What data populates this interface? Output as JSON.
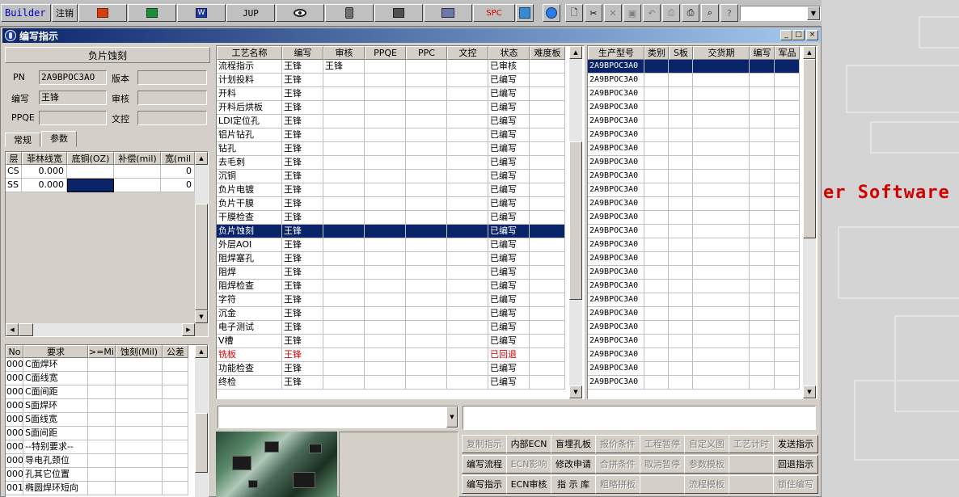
{
  "toolbar": {
    "builder_label": "Builder",
    "logout_label": "注销",
    "jup_label": "JUP",
    "spc_label": "SPC",
    "dropdown_value": ""
  },
  "background": {
    "text": "er Software"
  },
  "window": {
    "title": "编写指示",
    "min": "_",
    "max": "□",
    "close": "×"
  },
  "left": {
    "process_title": "负片蚀刻",
    "pn_label": "PN",
    "pn_value": "2A9BPOC3AO",
    "version_label": "版本",
    "version_value": "",
    "writer_label": "编写",
    "writer_value": "王锋",
    "review_label": "审核",
    "review_value": "",
    "ppqe_label": "PPQE",
    "ppqe_value": "",
    "doc_label": "文控",
    "doc_value": "",
    "tabs": [
      "常规",
      "参数"
    ],
    "layer_grid": {
      "headers": [
        "层",
        "菲林线宽",
        "底铜(OZ)",
        "补偿(mil)",
        "宽(mil"
      ],
      "rows": [
        {
          "layer": "CS",
          "film": "0.000",
          "copper": "",
          "comp": "",
          "width": "0"
        },
        {
          "layer": "SS",
          "film": "0.000",
          "copper": "",
          "comp": "",
          "width": "0"
        }
      ]
    },
    "req_grid": {
      "headers": [
        "No",
        "要求",
        ">=Mil",
        "蚀刻(Mil)",
        "公差"
      ],
      "rows": [
        {
          "no": "000",
          "req": "C面焊环"
        },
        {
          "no": "000",
          "req": "C面线宽"
        },
        {
          "no": "000",
          "req": "C面间距"
        },
        {
          "no": "000",
          "req": "S面焊环"
        },
        {
          "no": "000",
          "req": "S面线宽"
        },
        {
          "no": "000",
          "req": "S面间距"
        },
        {
          "no": "000",
          "req": "--特别要求--"
        },
        {
          "no": "000",
          "req": "导电孔颈位"
        },
        {
          "no": "000",
          "req": "孔其它位置"
        },
        {
          "no": "001",
          "req": "椭圆焊环短向"
        }
      ]
    }
  },
  "process_grid": {
    "headers": [
      "工艺名称",
      "编写",
      "审核",
      "PPQE",
      "PPC",
      "文控",
      "状态",
      "难度板"
    ],
    "rows": [
      {
        "name": "流程指示",
        "writer": "王锋",
        "review": "王锋",
        "status": "已审核"
      },
      {
        "name": "计划投料",
        "writer": "王锋",
        "review": "",
        "status": "已编写"
      },
      {
        "name": "开料",
        "writer": "王锋",
        "review": "",
        "status": "已编写"
      },
      {
        "name": "开料后烘板",
        "writer": "王锋",
        "review": "",
        "status": "已编写"
      },
      {
        "name": "LDI定位孔",
        "writer": "王锋",
        "review": "",
        "status": "已编写"
      },
      {
        "name": "铝片钻孔",
        "writer": "王锋",
        "review": "",
        "status": "已编写"
      },
      {
        "name": "钻孔",
        "writer": "王锋",
        "review": "",
        "status": "已编写"
      },
      {
        "name": "去毛刺",
        "writer": "王锋",
        "review": "",
        "status": "已编写"
      },
      {
        "name": "沉铜",
        "writer": "王锋",
        "review": "",
        "status": "已编写"
      },
      {
        "name": "负片电镀",
        "writer": "王锋",
        "review": "",
        "status": "已编写"
      },
      {
        "name": "负片干膜",
        "writer": "王锋",
        "review": "",
        "status": "已编写"
      },
      {
        "name": "干膜检查",
        "writer": "王锋",
        "review": "",
        "status": "已编写"
      },
      {
        "name": "负片蚀刻",
        "writer": "王锋",
        "review": "",
        "status": "已编写",
        "selected": true
      },
      {
        "name": "外层AOI",
        "writer": "王锋",
        "review": "",
        "status": "已编写"
      },
      {
        "name": "阻焊塞孔",
        "writer": "王锋",
        "review": "",
        "status": "已编写"
      },
      {
        "name": "阻焊",
        "writer": "王锋",
        "review": "",
        "status": "已编写"
      },
      {
        "name": "阻焊检查",
        "writer": "王锋",
        "review": "",
        "status": "已编写"
      },
      {
        "name": "字符",
        "writer": "王锋",
        "review": "",
        "status": "已编写"
      },
      {
        "name": "沉金",
        "writer": "王锋",
        "review": "",
        "status": "已编写"
      },
      {
        "name": "电子测试",
        "writer": "王锋",
        "review": "",
        "status": "已编写"
      },
      {
        "name": "V槽",
        "writer": "王锋",
        "review": "",
        "status": "已编写"
      },
      {
        "name": "铣板",
        "writer": "王锋",
        "review": "",
        "status": "已回退",
        "red": true
      },
      {
        "name": "功能检查",
        "writer": "王锋",
        "review": "",
        "status": "已编写"
      },
      {
        "name": "终检",
        "writer": "王锋",
        "review": "",
        "status": "已编写"
      }
    ]
  },
  "model_grid": {
    "headers": [
      "生产型号",
      "类别",
      "S板",
      "交货期",
      "编写",
      "军品"
    ],
    "rows": [
      "2A9BPOC3A0",
      "2A9BPOC3A0",
      "2A9BPOC3A0",
      "2A9BPOC3A0",
      "2A9BPOC3A0",
      "2A9BPOC3A0",
      "2A9BPOC3A0",
      "2A9BPOC3A0",
      "2A9BPOC3A0",
      "2A9BPOC3A0",
      "2A9BPOC3A0",
      "2A9BPOC3A0",
      "2A9BPOC3A0",
      "2A9BPOC3A0",
      "2A9BPOC3A0",
      "2A9BPOC3A0",
      "2A9BPOC3A0",
      "2A9BPOC3A0",
      "2A9BPOC3A0",
      "2A9BPOC3A0",
      "2A9BPOC3A0",
      "2A9BPOC3A0",
      "2A9BPOC3A0",
      "2A9BPOC3A0"
    ]
  },
  "buttons": {
    "row1": [
      {
        "label": "复制指示",
        "enabled": false
      },
      {
        "label": "内部ECN",
        "enabled": true
      },
      {
        "label": "盲埋孔板",
        "enabled": true
      },
      {
        "label": "报价条件",
        "enabled": false
      },
      {
        "label": "工程暂停",
        "enabled": false
      },
      {
        "label": "自定义图",
        "enabled": false
      },
      {
        "label": "工艺计时",
        "enabled": false
      },
      {
        "label": "发送指示",
        "enabled": true
      }
    ],
    "row2": [
      {
        "label": "编写流程",
        "enabled": true
      },
      {
        "label": "ECN影响",
        "enabled": false
      },
      {
        "label": "修改申请",
        "enabled": true
      },
      {
        "label": "合拼条件",
        "enabled": false
      },
      {
        "label": "取消暂停",
        "enabled": false
      },
      {
        "label": "参数模板",
        "enabled": false
      },
      {
        "label": "",
        "enabled": false
      },
      {
        "label": "回退指示",
        "enabled": true
      }
    ],
    "row3": [
      {
        "label": "编写指示",
        "enabled": true
      },
      {
        "label": "ECN审核",
        "enabled": true
      },
      {
        "label": "指 示 库",
        "enabled": true
      },
      {
        "label": "粗略拼板",
        "enabled": false
      },
      {
        "label": "",
        "enabled": false
      },
      {
        "label": "流程模板",
        "enabled": false
      },
      {
        "label": "",
        "enabled": false
      },
      {
        "label": "锁住编写",
        "enabled": false
      }
    ]
  },
  "colors": {
    "selection": "#0a246a",
    "title_start": "#0a246a",
    "title_end": "#a6caf0",
    "red_text": "#e00000",
    "window_bg": "#d4d0c8"
  }
}
